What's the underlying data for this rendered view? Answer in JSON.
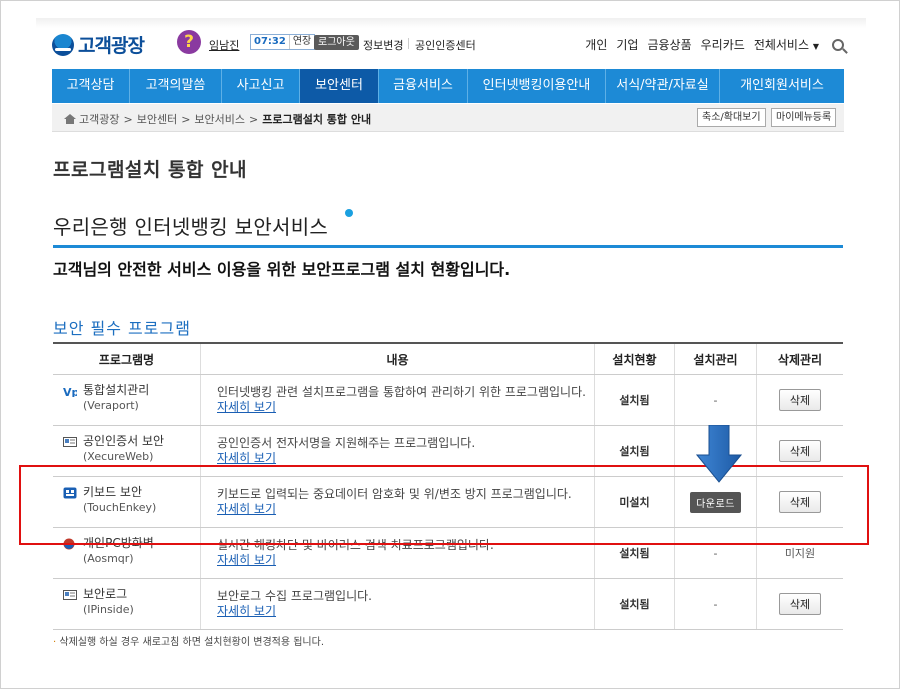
{
  "header": {
    "logo": "고객광장",
    "help_label": "?",
    "user_name": "임남진",
    "timer": "07:32",
    "extend": "연장",
    "logout": "로그아웃",
    "info_change": "정보변경",
    "cert_center": "공인인증센터",
    "top_links": [
      "개인",
      "기업",
      "금융상품",
      "우리카드",
      "전체서비스"
    ],
    "caret": "▼"
  },
  "nav": {
    "items": [
      "고객상담",
      "고객의말씀",
      "사고신고",
      "보안센터",
      "금융서비스",
      "인터넷뱅킹이용안내",
      "서식/약관/자료실",
      "개인회원서비스"
    ],
    "active_index": 3
  },
  "breadcrumb": {
    "items": [
      "고객광장",
      "보안센터",
      "보안서비스",
      "프로그램설치 통합 안내"
    ],
    "separator": ">",
    "zoom_button": "축소/확대보기",
    "mymenu_button": "마이메뉴등록"
  },
  "page": {
    "title": "프로그램설치 통합 안내",
    "subtitle": "우리은행 인터넷뱅킹 보안서비스",
    "lead": "고객님의 안전한 서비스 이용을 위한 보안프로그램 설치 현황입니다.",
    "section": "보안 필수 프로그램"
  },
  "table": {
    "headers": [
      "프로그램명",
      "내용",
      "설치현황",
      "설치관리",
      "삭제관리"
    ],
    "rows": [
      {
        "icon": "veraport-icon",
        "name": "통합설치관리",
        "sub": "(Veraport)",
        "desc": "인터넷뱅킹 관련 설치프로그램을 통합하여 관리하기 위한 프로그램입니다.",
        "link": "자세히 보기",
        "status": "설치됨",
        "manage": "-",
        "delete": "삭제"
      },
      {
        "icon": "cert-icon",
        "name": "공인인증서 보안",
        "sub": "(XecureWeb)",
        "desc": "공인인증서 전자서명을 지원해주는 프로그램입니다.",
        "link": "자세히 보기",
        "status": "설치됨",
        "manage": "",
        "delete": "삭제"
      },
      {
        "icon": "keyboard-icon",
        "name": "키보드 보안",
        "sub": "(TouchEnkey)",
        "desc": "키보드로 입력되는 중요데이터 암호화 및 위/변조 방지 프로그램입니다.",
        "link": "자세히 보기",
        "status": "미설치",
        "manage": "다운로드",
        "delete": "삭제"
      },
      {
        "icon": "pc-firewall-icon",
        "name": "개인PC방화벽",
        "sub": "(Aosmqr)",
        "desc": "실시간 해킹차단 및 바이러스 검색 치료프로그램입니다.",
        "link": "자세히 보기",
        "status": "설치됨",
        "manage": "-",
        "delete": "미지원"
      },
      {
        "icon": "security-log-icon",
        "name": "보안로그",
        "sub": "(IPinside)",
        "desc": "보안로그 수집 프로그램입니다.",
        "link": "자세히 보기",
        "status": "설치됨",
        "manage": "-",
        "delete": "삭제"
      }
    ]
  },
  "footnote": {
    "star": "·",
    "text": "삭제실행 하실 경우 새로고침 하면 설치현황이 변경적용 됩니다."
  },
  "colors": {
    "nav_blue": "#1d8ad6",
    "nav_active": "#0d5aa7",
    "highlight_red": "#e01010",
    "arrow_blue": "#2a6fc0"
  }
}
